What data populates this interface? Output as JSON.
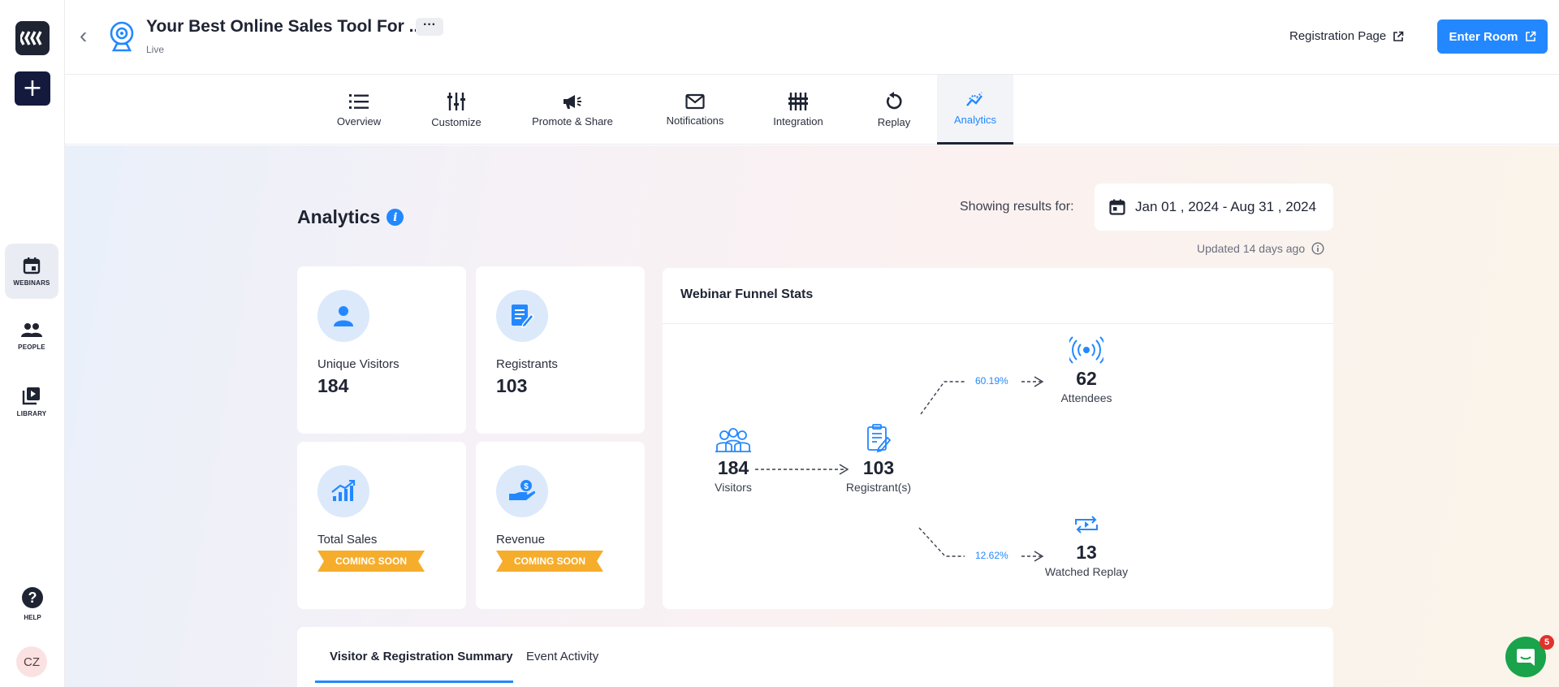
{
  "rail": {
    "items": [
      {
        "label": "WEBINARS",
        "icon": "calendar-icon",
        "active": true
      },
      {
        "label": "PEOPLE",
        "icon": "people-icon",
        "active": false
      },
      {
        "label": "LIBRARY",
        "icon": "library-icon",
        "active": false
      }
    ],
    "help_label": "HELP",
    "avatar_initials": "CZ"
  },
  "header": {
    "title": "Your Best Online Sales Tool For ...",
    "more": "···",
    "status": "Live",
    "registration_link": "Registration Page",
    "enter_button": "Enter Room"
  },
  "tabs": [
    {
      "label": "Overview",
      "icon": "list-icon"
    },
    {
      "label": "Customize",
      "icon": "sliders-icon"
    },
    {
      "label": "Promote & Share",
      "icon": "megaphone-icon"
    },
    {
      "label": "Notifications",
      "icon": "envelope-icon"
    },
    {
      "label": "Integration",
      "icon": "integration-icon"
    },
    {
      "label": "Replay",
      "icon": "replay-icon"
    },
    {
      "label": "Analytics",
      "icon": "analytics-icon",
      "active": true
    }
  ],
  "analytics": {
    "heading": "Analytics",
    "info": "i",
    "showing_label": "Showing results for:",
    "date_range": "Jan 01 , 2024 - Aug 31 , 2024",
    "updated": "Updated 14 days ago"
  },
  "stats": {
    "unique_visitors": {
      "label": "Unique Visitors",
      "value": "184"
    },
    "registrants": {
      "label": "Registrants",
      "value": "103"
    },
    "total_sales": {
      "label": "Total Sales",
      "badge": "COMING SOON"
    },
    "revenue": {
      "label": "Revenue",
      "badge": "COMING SOON"
    }
  },
  "funnel": {
    "title": "Webinar Funnel Stats",
    "visitors": {
      "value": "184",
      "label": "Visitors"
    },
    "registrants": {
      "value": "103",
      "label": "Registrant(s)"
    },
    "attendees": {
      "value": "62",
      "label": "Attendees",
      "pct": "60.19%"
    },
    "replay": {
      "value": "13",
      "label": "Watched Replay",
      "pct": "12.62%"
    }
  },
  "bottom_tabs": {
    "summary": "Visitor & Registration Summary",
    "activity": "Event Activity"
  },
  "chat_badge": "5",
  "colors": {
    "accent": "#2388ff",
    "ribbon": "#f6ad2b",
    "dark": "#1f2433"
  }
}
